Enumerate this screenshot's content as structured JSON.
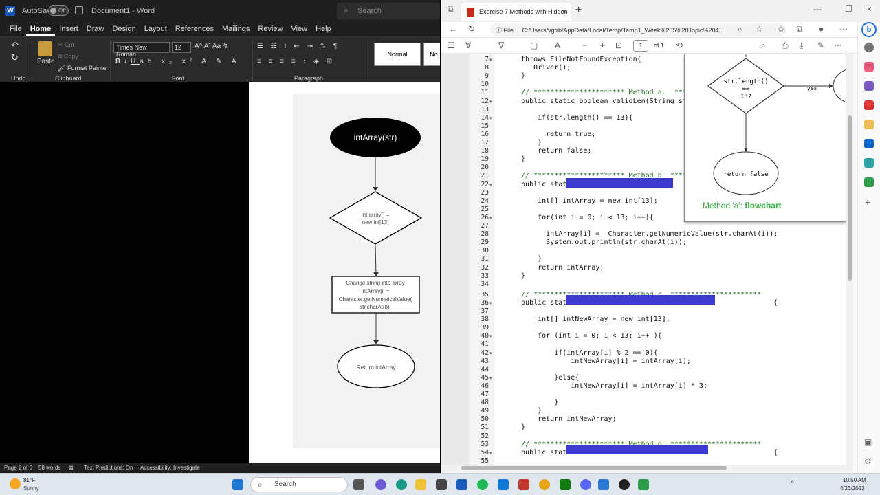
{
  "word": {
    "logo": "W",
    "autosave_label": "AutoSave",
    "autosave_toggle": "Off",
    "doc_title": "Document1 - Word",
    "search_placeholder": "Search",
    "tabs": [
      "File",
      "Home",
      "Insert",
      "Draw",
      "Design",
      "Layout",
      "References",
      "Mailings",
      "Review",
      "View",
      "Help"
    ],
    "active_tab": "Home",
    "ribbon": {
      "undo_group": "Undo",
      "paste": "Paste",
      "cut": "Cut",
      "copy": "Copy",
      "format_painter": "Format Painter",
      "clipboard_group": "Clipboard",
      "font_name": "Times New Roman",
      "font_size": "12",
      "font_group": "Font",
      "paragraph_group": "Paragraph",
      "style_normal": "Normal",
      "style_next": "No"
    },
    "flowchart": {
      "start": "intArray(str)",
      "decl_line1": "int array[] =",
      "decl_line2": "new int[13]",
      "proc_line1": "Change string into array",
      "proc_line2": "intArray[i] =",
      "proc_line3": "Character.getNumericalValue(",
      "proc_line4": "str.charAt(i));",
      "end": "Return intArray"
    },
    "status": {
      "page": "Page 2 of 6",
      "words": "58 words",
      "predictions": "Text Predictions: On",
      "accessibility": "Accessibility: Investigate"
    }
  },
  "edge": {
    "tab_title": "Exercise 7 Methods with Hidden",
    "url_prefix": "File",
    "url": "C:/Users/vgfrb/AppData/Local/Temp/Temp1_Week%205%20Topic%204...",
    "page_current": "1",
    "page_total": "of 1",
    "code_lines": [
      {
        "n": "7",
        "fold": true,
        "text": "  throws FileNotFoundException{"
      },
      {
        "n": "8",
        "text": "     Driver();"
      },
      {
        "n": "9",
        "text": "  }"
      },
      {
        "n": "10",
        "text": ""
      },
      {
        "n": "11",
        "text": "  // ********************** Method a.  ***********",
        "cmt": true
      },
      {
        "n": "12",
        "fold": true,
        "text": "  public static boolean validLen(String str){"
      },
      {
        "n": "13",
        "text": ""
      },
      {
        "n": "14",
        "fold": true,
        "text": "      if(str.length() == 13){"
      },
      {
        "n": "15",
        "text": ""
      },
      {
        "n": "16",
        "text": "        return true;"
      },
      {
        "n": "17",
        "text": "      }"
      },
      {
        "n": "18",
        "text": "      return false;"
      },
      {
        "n": "19",
        "text": "  }"
      },
      {
        "n": "20",
        "text": ""
      },
      {
        "n": "21",
        "text": "  // ********************** Method b  ***********",
        "cmt": true
      },
      {
        "n": "22",
        "fold": true,
        "text": "  public static                               {"
      },
      {
        "n": "23",
        "text": ""
      },
      {
        "n": "24",
        "text": "      int[] intArray = new int[13];"
      },
      {
        "n": "25",
        "text": ""
      },
      {
        "n": "26",
        "fold": true,
        "text": "      for(int i = 0; i < 13; i++){"
      },
      {
        "n": "27",
        "text": ""
      },
      {
        "n": "28",
        "text": "        intArray[i] =  Character.getNumericValue(str.charAt(i));"
      },
      {
        "n": "29",
        "text": "        System.out.println(str.charAt(i));"
      },
      {
        "n": "30",
        "text": ""
      },
      {
        "n": "31",
        "text": "      }"
      },
      {
        "n": "32",
        "text": "      return intArray;"
      },
      {
        "n": "33",
        "text": "  }"
      },
      {
        "n": "34",
        "text": ""
      },
      {
        "n": "35",
        "text": "  // ********************** Method c  **********************",
        "cmt": true
      },
      {
        "n": "36",
        "fold": true,
        "text": "  public static                                                {"
      },
      {
        "n": "37",
        "text": ""
      },
      {
        "n": "38",
        "text": "      int[] intNewArray = new int[13];"
      },
      {
        "n": "39",
        "text": ""
      },
      {
        "n": "40",
        "fold": true,
        "text": "      for (int i = 0; i < 13; i++ ){"
      },
      {
        "n": "41",
        "text": ""
      },
      {
        "n": "42",
        "fold": true,
        "text": "          if(intArray[i] % 2 == 0){"
      },
      {
        "n": "43",
        "text": "              intNewArray[i] = intArray[i];"
      },
      {
        "n": "44",
        "text": ""
      },
      {
        "n": "45",
        "fold": true,
        "text": "          }else{"
      },
      {
        "n": "46",
        "text": "              intNewArray[i] = intArray[i] * 3;"
      },
      {
        "n": "47",
        "text": ""
      },
      {
        "n": "48",
        "text": "          }"
      },
      {
        "n": "49",
        "text": "      }"
      },
      {
        "n": "50",
        "text": "      return intNewArray;"
      },
      {
        "n": "51",
        "text": "  }"
      },
      {
        "n": "52",
        "text": ""
      },
      {
        "n": "53",
        "text": "  // ********************** Method d  **********************",
        "cmt": true
      },
      {
        "n": "54",
        "fold": true,
        "text": "  public static                                                {"
      },
      {
        "n": "55",
        "text": ""
      }
    ],
    "popup": {
      "decision": "str.length()",
      "decision2": "==",
      "decision3": "13?",
      "yes": "yes",
      "ret_false": "return false",
      "caption_main": "Method 'a': ",
      "caption_bold": "flowchart"
    }
  },
  "taskbar": {
    "temp": "81°F",
    "weather": "Sunny",
    "search": "Search",
    "time": "10:50 AM",
    "date": "4/23/2023"
  },
  "colors": {
    "word_blue": "#185abd",
    "hidden_block": "#3b3bcf",
    "caption_green": "#3cb043"
  }
}
